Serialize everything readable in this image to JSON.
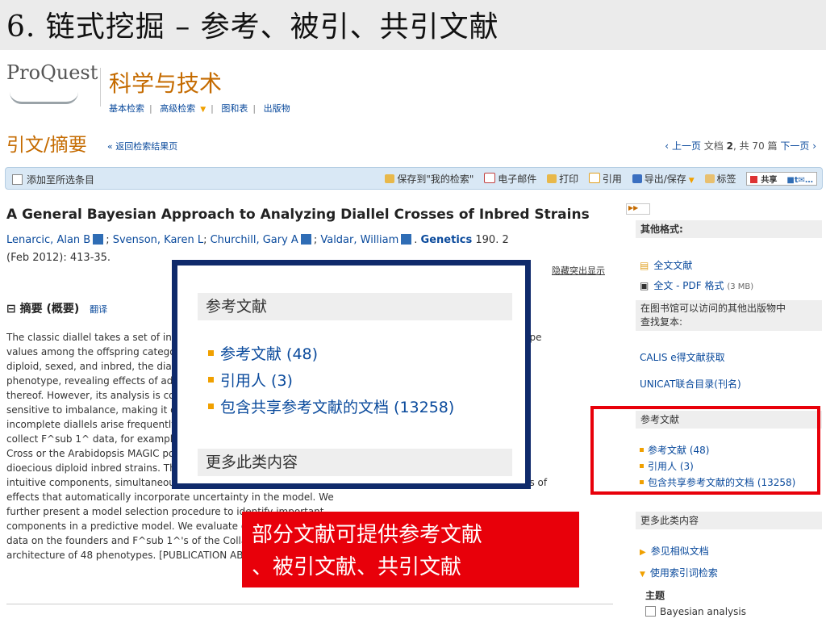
{
  "slide": {
    "title": "6. 链式挖掘 – 参考、被引、共引文献"
  },
  "header": {
    "logo": "ProQuest",
    "app_title": "科学与技术",
    "nav": [
      "基本检索",
      "高级检索",
      "图和表",
      "出版物"
    ]
  },
  "page": {
    "section_title": "引文/摘要",
    "back_link": "« 返回检索结果页",
    "pager": {
      "prev": "上一页",
      "doc_text_1": "文档",
      "doc_num": "2",
      "doc_text_2": ", 共 70 篇",
      "next": "下一页"
    }
  },
  "toolbar": {
    "add_to_selected": "添加至所选条目",
    "save_search": "保存到\"我的检索\"",
    "email": "电子邮件",
    "print": "打印",
    "cite": "引用",
    "export": "导出/保存",
    "tags": "标签",
    "share": "共享"
  },
  "article": {
    "title": "A General Bayesian Approach to Analyzing Diallel Crosses of Inbred Strains",
    "authors": [
      "Lenarcic, Alan B",
      "Svenson, Karen L",
      "Churchill, Gary A",
      "Valdar, William"
    ],
    "journal": "Genetics",
    "volume": "190. 2",
    "date_pages": "(Feb 2012): 413-35.",
    "hide_highlight": "隐藏突出显示"
  },
  "abstract": {
    "heading": "摘要 (概要)",
    "translate": "翻译",
    "lines": [
      "The classic diallel takes a set of inbred strains and crosses them in all possible pairings, measuring phenotype",
      "values among the offspring categorized by parentage. Here the parents are also measured, and parents are",
      "diploid, sexed, and inbred, the diallel can be modeled via a Bayesian hierarchical approach on a",
      "phenotype, revealing effects of additive, dominance and epistatic genetics, including sex-specific versions",
      "thereof. However, its analysis is complicated by the model's dimension, lack of replication, and highly",
      "sensitive to imbalance, making it difficult for practitioners. Unbalanced and",
      "incomplete diallels arise frequently in practice. We describe a model suited to experiments that",
      "collect F^sub 1^ data, for example in the context of the Collaborative",
      "Cross or the Arabidopsis MAGIC populations, where one collects data on",
      "dioecious diploid inbred strains. The model provides biologically",
      "intuitive components, simultaneously models and accommodates outliers, and provides shrinkage estimates of",
      "effects that automatically incorporate uncertainty in the model. We",
      "further present a model selection procedure to identify important",
      "components in a predictive model. We evaluate on a diallel",
      "data on the founders and F^sub 1^'s of the Collaborative Cross,",
      "architecture of 48 phenotypes. [PUBLICATION ABSTRACT]"
    ]
  },
  "sidebar": {
    "other_formats_heading": "其他格式:",
    "full_text": "全文文献",
    "pdf": "全文 - PDF 格式",
    "pdf_size": "(3 MB)",
    "find_copy": [
      "在图书馆可以访问的其他出版物中",
      "查找复本:"
    ],
    "calis": "CALIS e得文献获取",
    "unicat": "UNICAT联合目录(刊名)",
    "refs_heading": "参考文献",
    "refs": [
      "参考文献 (48)",
      "引用人 (3)",
      "包含共享参考文献的文档 (13258)"
    ],
    "more_heading": "更多此类内容",
    "see_similar": "参见相似文档",
    "index_search": "使用索引词检索",
    "subject_label": "主题",
    "subject_term": "Bayesian analysis"
  },
  "zoom": {
    "heading": "参考文献",
    "items": [
      "参考文献 (48)",
      "引用人 (3)",
      "包含共享参考文献的文档 (13258)"
    ],
    "more_heading": "更多此类内容"
  },
  "callout": {
    "lines": [
      "部分文献可提供参考文献",
      "、被引文献、共引文献"
    ]
  }
}
